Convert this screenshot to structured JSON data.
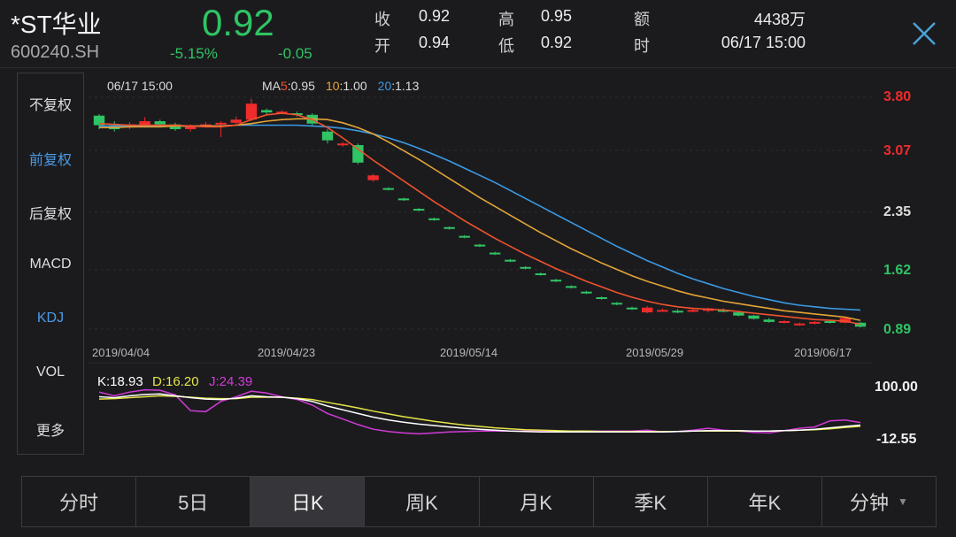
{
  "header": {
    "name": "*ST华业",
    "code": "600240.SH",
    "price": "0.92",
    "change_pct": "-5.15%",
    "change_abs": "-0.05",
    "quote": [
      {
        "label": "收",
        "value": "0.92"
      },
      {
        "label": "开",
        "value": "0.94"
      },
      {
        "label": "高",
        "value": "0.95"
      },
      {
        "label": "低",
        "value": "0.92"
      },
      {
        "label": "额",
        "value": "4438万"
      },
      {
        "label": "时",
        "value": "06/17 15:00"
      }
    ]
  },
  "menu": [
    "不复权",
    "前复权",
    "后复权",
    "MACD",
    "KDJ",
    "VOL",
    "更多"
  ],
  "menu_active": [
    1,
    4
  ],
  "chart_info": {
    "date": "06/17 15:00",
    "ma5_prefix": "MA",
    "ma5_num": "5",
    "ma5_val": ":0.95",
    "ma10_num": "10",
    "ma10_val": ":1.00",
    "ma20_num": "20",
    "ma20_val": ":1.13",
    "kdj_k": "K:18.93",
    "kdj_d": "D:16.20",
    "kdj_j": "J:24.39"
  },
  "price_axis": [
    "3.80",
    "3.07",
    "2.35",
    "1.62",
    "0.89"
  ],
  "kdj_axis": [
    "100.00",
    "-12.55"
  ],
  "x_axis": [
    "2019/04/04",
    "2019/04/23",
    "2019/05/14",
    "2019/05/29",
    "2019/06/17"
  ],
  "tabs": [
    "分时",
    "5日",
    "日K",
    "周K",
    "月K",
    "季K",
    "年K",
    "分钟"
  ],
  "tab_active": 2,
  "colors": {
    "up": "#ef2b2b",
    "down": "#2fc464",
    "ma5": "#f0522d",
    "ma10": "#e3a436",
    "ma20": "#3a9ae3",
    "k": "#ffffff",
    "d": "#e5e548",
    "j": "#d13bd6",
    "accent": "#4a9ae6"
  },
  "chart_data": {
    "type": "candlestick",
    "ylim": [
      0.89,
      3.8
    ],
    "x_ticks": [
      "2019/04/04",
      "2019/04/23",
      "2019/05/14",
      "2019/05/29",
      "2019/06/17"
    ],
    "candles": [
      [
        3.57,
        3.45,
        3.59,
        3.4
      ],
      [
        3.45,
        3.4,
        3.5,
        3.37
      ],
      [
        3.42,
        3.46,
        3.49,
        3.4
      ],
      [
        3.45,
        3.5,
        3.55,
        3.42
      ],
      [
        3.5,
        3.46,
        3.52,
        3.43
      ],
      [
        3.46,
        3.4,
        3.48,
        3.38
      ],
      [
        3.4,
        3.44,
        3.46,
        3.37
      ],
      [
        3.44,
        3.46,
        3.49,
        3.43
      ],
      [
        3.46,
        3.48,
        3.5,
        3.3
      ],
      [
        3.48,
        3.52,
        3.56,
        3.46
      ],
      [
        3.52,
        3.72,
        3.78,
        3.5
      ],
      [
        3.64,
        3.61,
        3.66,
        3.58
      ],
      [
        3.61,
        3.62,
        3.64,
        3.59
      ],
      [
        3.6,
        3.58,
        3.62,
        3.56
      ],
      [
        3.58,
        3.47,
        3.6,
        3.44
      ],
      [
        3.37,
        3.26,
        3.4,
        3.22
      ],
      [
        3.2,
        3.22,
        3.24,
        3.18
      ],
      [
        3.2,
        2.98,
        3.22,
        2.96
      ],
      [
        2.76,
        2.82,
        2.84,
        2.74
      ],
      [
        2.66,
        2.64,
        2.67,
        2.63
      ],
      [
        2.53,
        2.51,
        2.54,
        2.5
      ],
      [
        2.4,
        2.38,
        2.41,
        2.37
      ],
      [
        2.28,
        2.26,
        2.29,
        2.25
      ],
      [
        2.17,
        2.15,
        2.18,
        2.14
      ],
      [
        2.06,
        2.04,
        2.07,
        2.03
      ],
      [
        1.95,
        1.93,
        1.96,
        1.92
      ],
      [
        1.85,
        1.83,
        1.86,
        1.82
      ],
      [
        1.76,
        1.74,
        1.77,
        1.73
      ],
      [
        1.67,
        1.65,
        1.68,
        1.64
      ],
      [
        1.59,
        1.57,
        1.6,
        1.56
      ],
      [
        1.51,
        1.49,
        1.52,
        1.48
      ],
      [
        1.43,
        1.41,
        1.44,
        1.4
      ],
      [
        1.36,
        1.34,
        1.37,
        1.33
      ],
      [
        1.29,
        1.27,
        1.3,
        1.26
      ],
      [
        1.22,
        1.2,
        1.23,
        1.19
      ],
      [
        1.16,
        1.14,
        1.17,
        1.13
      ],
      [
        1.1,
        1.16,
        1.18,
        1.09
      ],
      [
        1.13,
        1.13,
        1.15,
        1.11
      ],
      [
        1.12,
        1.11,
        1.14,
        1.09
      ],
      [
        1.12,
        1.13,
        1.15,
        1.1
      ],
      [
        1.12,
        1.15,
        1.16,
        1.1
      ],
      [
        1.13,
        1.12,
        1.15,
        1.1
      ],
      [
        1.1,
        1.06,
        1.12,
        1.05
      ],
      [
        1.06,
        1.02,
        1.07,
        1.01
      ],
      [
        1.01,
        0.98,
        1.03,
        0.97
      ],
      [
        0.98,
        0.99,
        1.0,
        0.96
      ],
      [
        0.94,
        0.96,
        0.97,
        0.93
      ],
      [
        0.97,
        0.98,
        0.99,
        0.95
      ],
      [
        0.99,
        0.97,
        1.0,
        0.96
      ],
      [
        0.97,
        1.03,
        1.04,
        0.96
      ],
      [
        0.97,
        0.92,
        0.98,
        0.91
      ]
    ],
    "ma5": [
      3.47,
      3.46,
      3.45,
      3.45,
      3.45,
      3.45,
      3.44,
      3.43,
      3.43,
      3.45,
      3.52,
      3.58,
      3.6,
      3.58,
      3.52,
      3.42,
      3.29,
      3.15,
      3.01,
      2.88,
      2.75,
      2.62,
      2.49,
      2.37,
      2.25,
      2.14,
      2.03,
      1.93,
      1.83,
      1.74,
      1.65,
      1.57,
      1.49,
      1.42,
      1.35,
      1.29,
      1.24,
      1.2,
      1.17,
      1.15,
      1.14,
      1.13,
      1.11,
      1.09,
      1.07,
      1.05,
      1.03,
      1.01,
      1.0,
      0.99,
      0.95
    ],
    "ma10": [
      3.42,
      3.42,
      3.43,
      3.43,
      3.43,
      3.44,
      3.44,
      3.44,
      3.44,
      3.45,
      3.47,
      3.5,
      3.52,
      3.53,
      3.53,
      3.52,
      3.48,
      3.42,
      3.34,
      3.24,
      3.13,
      3.02,
      2.9,
      2.78,
      2.66,
      2.54,
      2.43,
      2.32,
      2.21,
      2.1,
      2.0,
      1.9,
      1.81,
      1.72,
      1.64,
      1.56,
      1.49,
      1.43,
      1.37,
      1.32,
      1.28,
      1.24,
      1.21,
      1.18,
      1.15,
      1.12,
      1.1,
      1.08,
      1.06,
      1.04,
      1.0
    ],
    "ma20": [
      3.44,
      3.44,
      3.44,
      3.44,
      3.44,
      3.44,
      3.44,
      3.44,
      3.44,
      3.45,
      3.45,
      3.45,
      3.45,
      3.45,
      3.44,
      3.43,
      3.41,
      3.38,
      3.34,
      3.29,
      3.23,
      3.16,
      3.08,
      3.0,
      2.91,
      2.82,
      2.73,
      2.63,
      2.53,
      2.43,
      2.33,
      2.23,
      2.13,
      2.03,
      1.93,
      1.84,
      1.75,
      1.67,
      1.59,
      1.52,
      1.46,
      1.4,
      1.35,
      1.3,
      1.26,
      1.22,
      1.19,
      1.17,
      1.15,
      1.14,
      1.13
    ],
    "kdj_ylim": [
      -12.55,
      100.0
    ],
    "k": [
      80,
      78,
      82,
      85,
      86,
      82,
      78,
      75,
      74,
      77,
      82,
      80,
      79,
      76,
      70,
      60,
      52,
      44,
      36,
      30,
      25,
      21,
      18,
      15,
      12,
      10,
      8,
      6,
      5,
      4,
      4,
      4,
      4,
      4,
      4,
      4,
      4,
      4,
      5,
      6,
      7,
      7,
      7,
      6,
      6,
      7,
      8,
      10,
      13,
      16,
      18.93
    ],
    "d": [
      75,
      76,
      78,
      80,
      82,
      81,
      79,
      77,
      76,
      76,
      79,
      79,
      79,
      77,
      74,
      68,
      62,
      56,
      49,
      43,
      37,
      32,
      27,
      23,
      19,
      16,
      13,
      11,
      9,
      8,
      7,
      6,
      6,
      5,
      5,
      5,
      5,
      5,
      5,
      6,
      6,
      6,
      6,
      6,
      6,
      7,
      8,
      9,
      11,
      14,
      16.2
    ],
    "j": [
      90,
      82,
      90,
      95,
      94,
      84,
      50,
      48,
      70,
      80,
      92,
      88,
      80,
      74,
      62,
      44,
      32,
      20,
      10,
      5,
      2,
      0,
      2,
      4,
      5,
      6,
      6,
      6,
      6,
      6,
      6,
      6,
      6,
      6,
      6,
      6,
      8,
      4,
      5,
      8,
      12,
      8,
      6,
      3,
      2,
      7,
      12,
      15,
      28,
      30,
      24.39
    ]
  }
}
